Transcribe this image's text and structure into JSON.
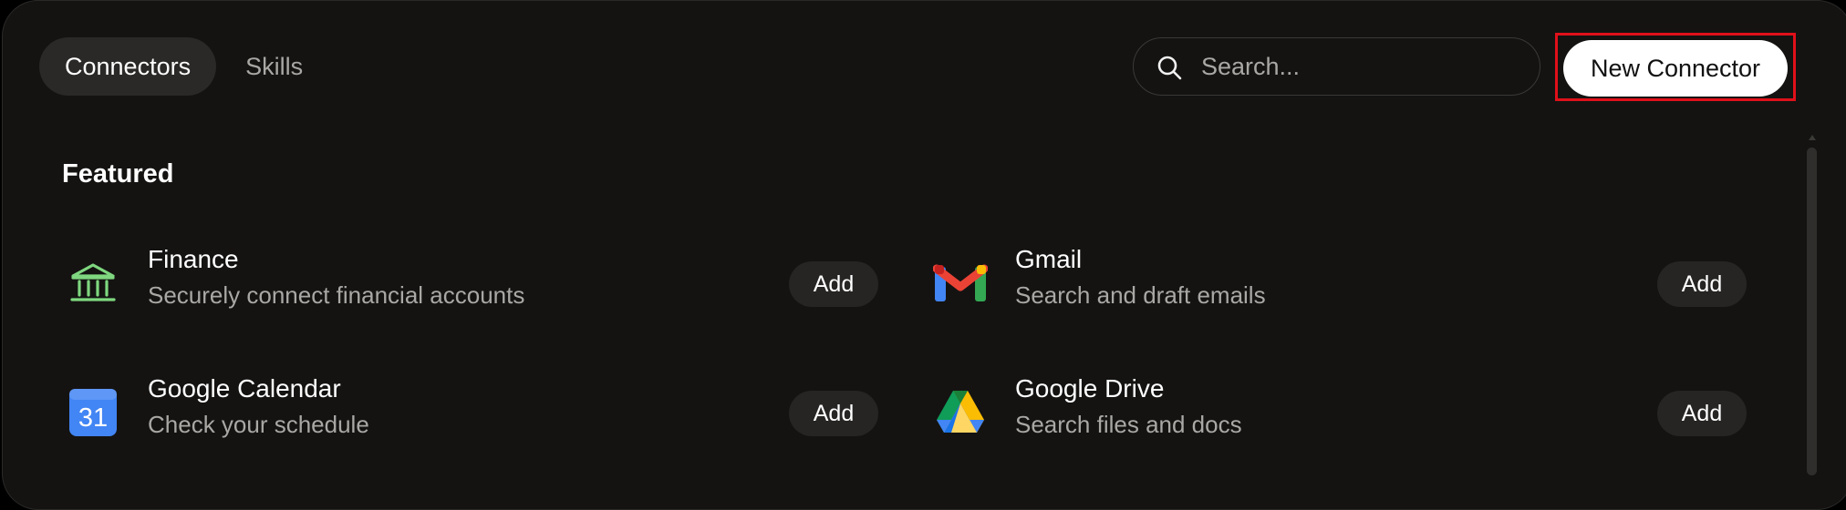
{
  "tabs": [
    {
      "label": "Connectors",
      "active": true
    },
    {
      "label": "Skills",
      "active": false
    }
  ],
  "search": {
    "placeholder": "Search...",
    "value": ""
  },
  "toolbar": {
    "new_connector_label": "New Connector"
  },
  "section": {
    "title": "Featured"
  },
  "connectors": [
    {
      "name": "Finance",
      "description": "Securely connect financial accounts",
      "add_label": "Add",
      "icon": "bank-icon"
    },
    {
      "name": "Gmail",
      "description": "Search and draft emails",
      "add_label": "Add",
      "icon": "gmail-icon"
    },
    {
      "name": "Google Calendar",
      "description": "Check your schedule",
      "add_label": "Add",
      "icon": "google-calendar-icon",
      "icon_text": "31"
    },
    {
      "name": "Google Drive",
      "description": "Search files and docs",
      "add_label": "Add",
      "icon": "google-drive-icon"
    }
  ],
  "colors": {
    "background": "#141312",
    "accent_outline": "#e0101a",
    "finance_green": "#7fd77f",
    "text_secondary": "#a9a8a5"
  }
}
